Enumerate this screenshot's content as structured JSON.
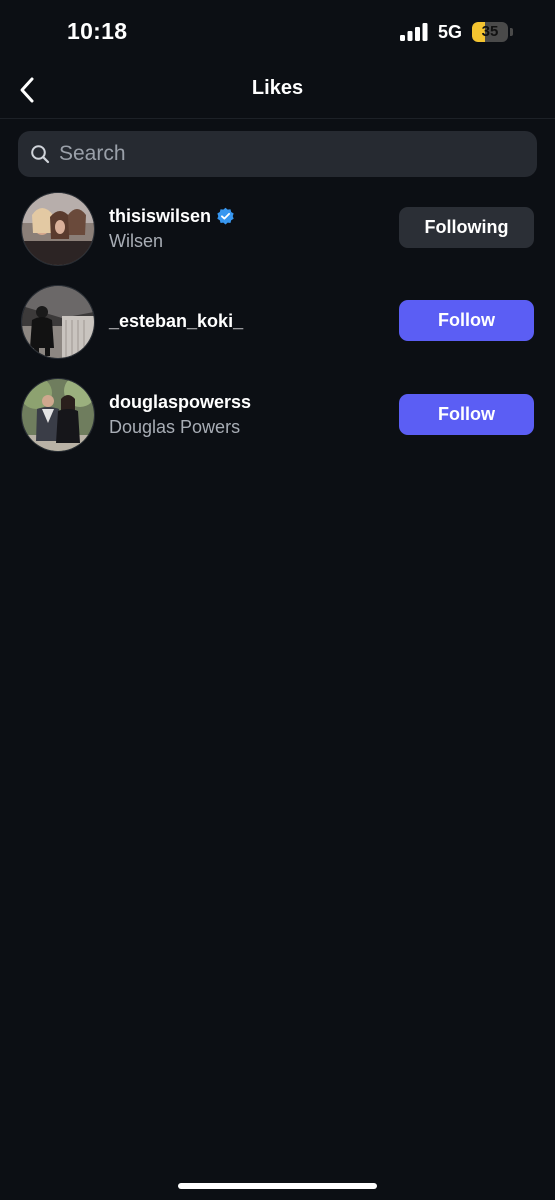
{
  "status_bar": {
    "time": "10:18",
    "network": "5G",
    "battery_level": "35",
    "battery_fraction": 0.35,
    "battery_color": "#f4c430",
    "icons": [
      "signal-icon",
      "battery-icon"
    ]
  },
  "header": {
    "title": "Likes",
    "back_icon": "chevron-left-icon"
  },
  "search": {
    "placeholder": "Search",
    "value": "",
    "icon": "search-icon"
  },
  "users": [
    {
      "username": "thisiswilsen",
      "display_name": "Wilsen",
      "verified": true,
      "button_label": "Following"
    },
    {
      "username": "_esteban_koki_",
      "display_name": "",
      "verified": false,
      "button_label": "Follow"
    },
    {
      "username": "douglaspowerss",
      "display_name": "Douglas Powers",
      "verified": false,
      "button_label": "Follow"
    }
  ],
  "colors": {
    "background": "#0c0f14",
    "follow_button": "#5b5ef4",
    "following_button": "#2b2f36",
    "verified_badge": "#3897f0",
    "secondary_text": "#a8adb5"
  }
}
